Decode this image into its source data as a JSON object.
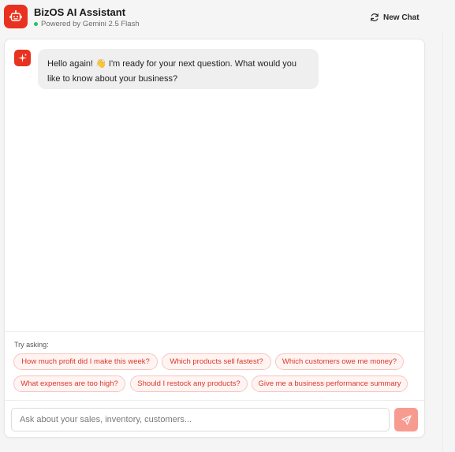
{
  "header": {
    "title": "BizOS AI Assistant",
    "subtitle": "Powered by Gemini 2.5 Flash",
    "new_chat_label": "New Chat",
    "status_color": "#22c55e"
  },
  "chat": {
    "messages": [
      {
        "role": "assistant",
        "text": "Hello again! 👋 I'm ready for your next question. What would you like to know about your business?"
      }
    ]
  },
  "suggestions": {
    "label": "Try asking:",
    "items": [
      "How much profit did I make this week?",
      "Which products sell fastest?",
      "Which customers owe me money?",
      "What expenses are too high?",
      "Should I restock any products?",
      "Give me a business performance summary"
    ]
  },
  "composer": {
    "placeholder": "Ask about your sales, inventory, customers...",
    "value": ""
  },
  "theme": {
    "accent": "#e8321f",
    "chip_text": "#d9382a",
    "send_button": "#f79b91"
  },
  "icons": {
    "logo": "robot-icon",
    "new_chat": "refresh-icon",
    "bot_avatar": "sparkle-icon",
    "send": "send-icon"
  }
}
